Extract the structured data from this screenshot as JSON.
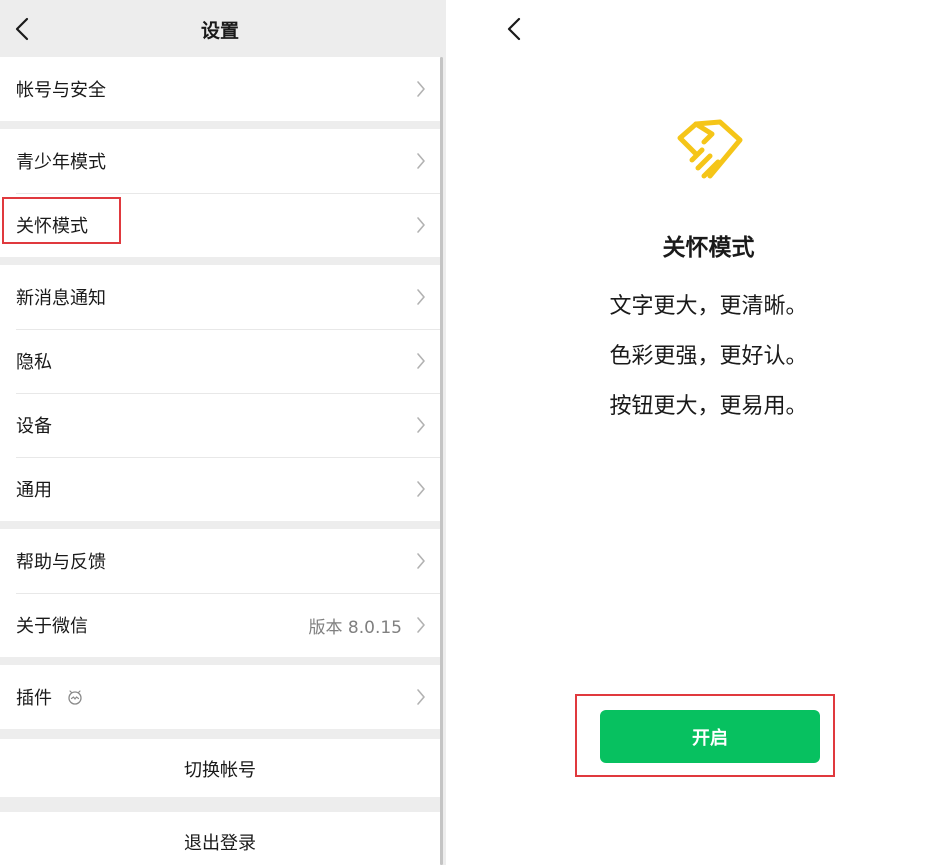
{
  "settings": {
    "title": "设置",
    "groups": [
      {
        "items": [
          {
            "label": "帐号与安全"
          }
        ]
      },
      {
        "items": [
          {
            "label": "青少年模式"
          },
          {
            "label": "关怀模式"
          }
        ]
      },
      {
        "items": [
          {
            "label": "新消息通知"
          },
          {
            "label": "隐私"
          },
          {
            "label": "设备"
          },
          {
            "label": "通用"
          }
        ]
      },
      {
        "items": [
          {
            "label": "帮助与反馈"
          },
          {
            "label": "关于微信",
            "value": "版本 8.0.15"
          }
        ]
      },
      {
        "items": [
          {
            "label": "插件",
            "icon": "plugin-icon"
          }
        ]
      }
    ],
    "switch_account": "切换帐号",
    "logout": "退出登录"
  },
  "care_mode": {
    "title": "关怀模式",
    "lines": [
      "文字更大，更清晰。",
      "色彩更强，更好认。",
      "按钮更大，更易用。"
    ],
    "button_label": "开启",
    "icon": "care-hand-icon"
  },
  "colors": {
    "accent_green": "#07c160",
    "care_icon_yellow": "#f5c518",
    "highlight_red": "#e0393e",
    "background_gray": "#ededed"
  }
}
